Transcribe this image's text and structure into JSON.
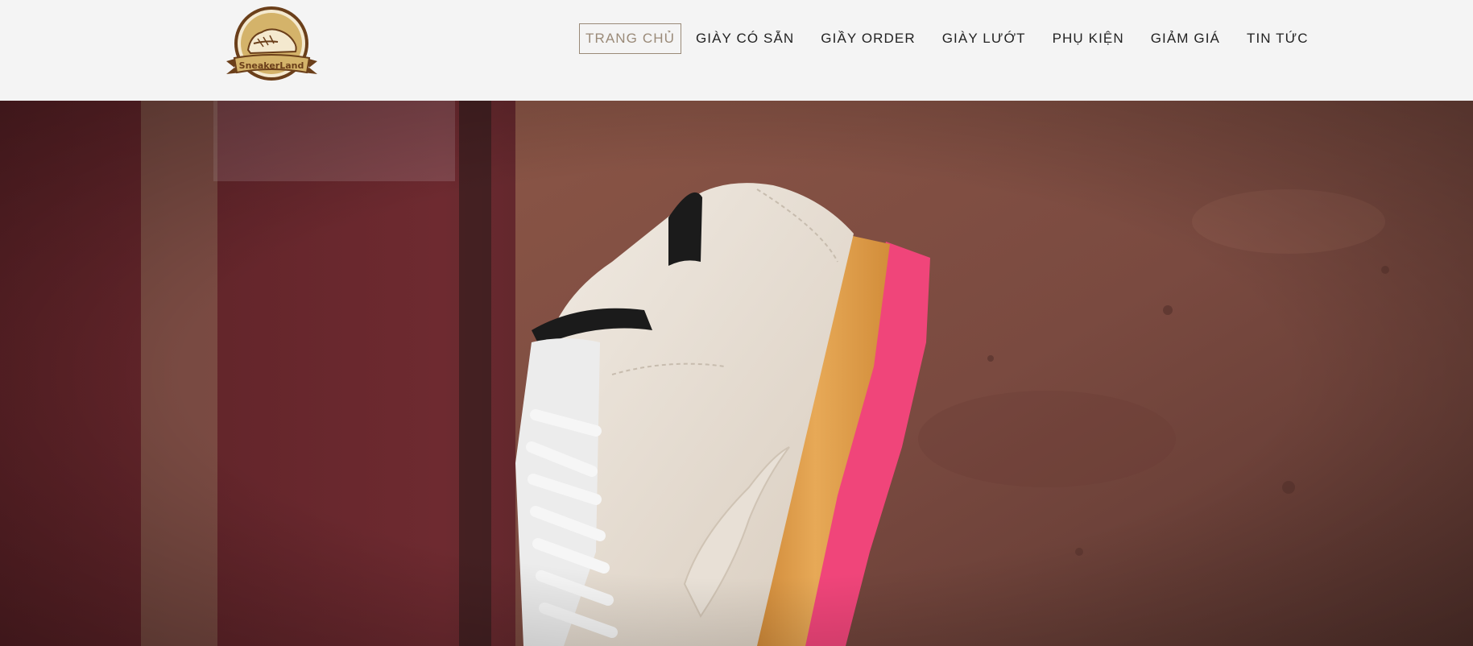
{
  "brand": {
    "logo_text": "SneakerLand",
    "logo_icon": "sneaker-emblem-icon",
    "colors": {
      "gold": "#d4b36a",
      "brown": "#6b3f1a"
    }
  },
  "nav": {
    "items": [
      {
        "label": "TRANG CHỦ",
        "active": true
      },
      {
        "label": "GIÀY CÓ SẴN",
        "active": false
      },
      {
        "label": "GIẦY ORDER",
        "active": false
      },
      {
        "label": "GIÀY LƯỚT",
        "active": false
      },
      {
        "label": "PHỤ KIỆN",
        "active": false
      },
      {
        "label": "GIẢM GIÁ",
        "active": false
      },
      {
        "label": "TIN TỨC",
        "active": false
      }
    ],
    "active_color": "#9a8a78",
    "text_color": "#222222"
  },
  "hero": {
    "image": "sneaker-against-rusted-wall",
    "colors": {
      "wall": "#7a4a3f",
      "shoe_suede": "#e6ddd2",
      "sole_gum": "#e0a04a",
      "sole_pink": "#f0457a"
    }
  }
}
